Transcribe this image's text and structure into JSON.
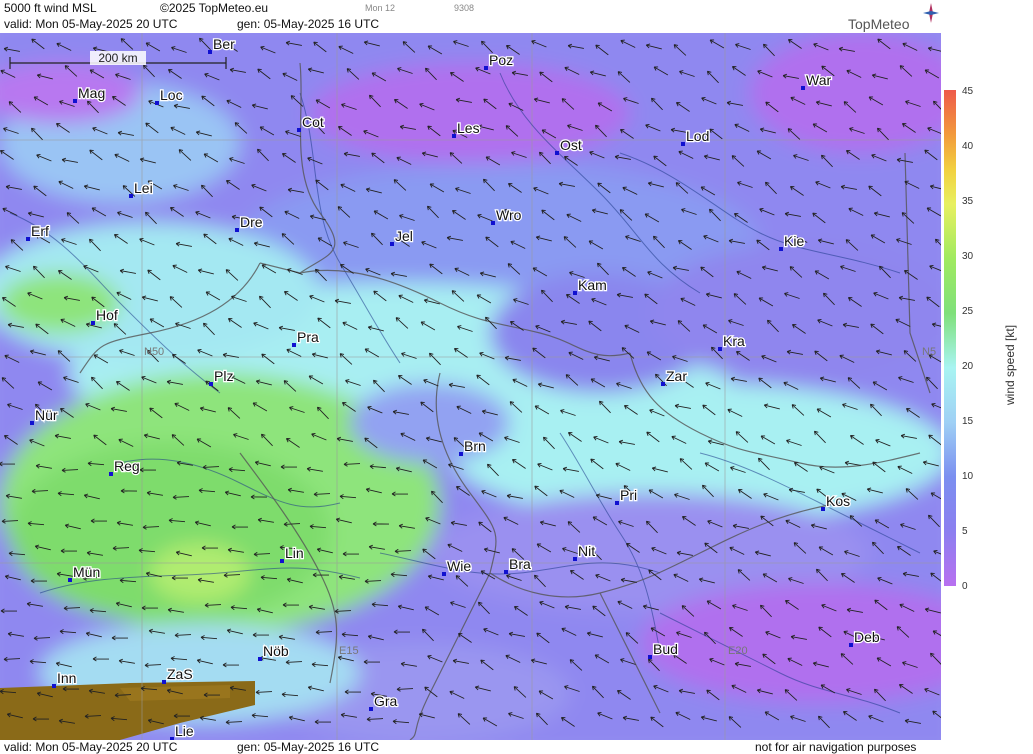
{
  "header": {
    "product": "5000 ft wind MSL",
    "copyright": "©2025 TopMeteo.eu",
    "valid": "valid:  Mon  05-May-2025  20 UTC",
    "gen": "gen: 05-May-2025 16 UTC",
    "step": "Mon 12",
    "code": "9308",
    "logo": "TopMeteo"
  },
  "footer": {
    "valid": "valid:  Mon  05-May-2025  20 UTC",
    "gen": "gen: 05-May-2025 16 UTC",
    "note": "not for air navigation purposes"
  },
  "map": {
    "scale_label": "200 km",
    "grid_labels": [
      "N50",
      "E15",
      "E20",
      "N5"
    ],
    "cities": [
      {
        "name": "Ber"
      },
      {
        "name": "Poz"
      },
      {
        "name": "War"
      },
      {
        "name": "Mag"
      },
      {
        "name": "Loc"
      },
      {
        "name": "Cot"
      },
      {
        "name": "Les"
      },
      {
        "name": "Ost"
      },
      {
        "name": "Lod"
      },
      {
        "name": "Lei"
      },
      {
        "name": "Dre"
      },
      {
        "name": "Wro"
      },
      {
        "name": "Erf"
      },
      {
        "name": "Jel"
      },
      {
        "name": "Kie"
      },
      {
        "name": "Kam"
      },
      {
        "name": "Hof"
      },
      {
        "name": "Pra"
      },
      {
        "name": "Kra"
      },
      {
        "name": "Plz"
      },
      {
        "name": "Zar"
      },
      {
        "name": "Nür"
      },
      {
        "name": "Brn"
      },
      {
        "name": "Reg"
      },
      {
        "name": "Pri"
      },
      {
        "name": "Kos"
      },
      {
        "name": "Lin"
      },
      {
        "name": "Nit"
      },
      {
        "name": "Mün"
      },
      {
        "name": "Wie"
      },
      {
        "name": "Bra"
      },
      {
        "name": "Deb"
      },
      {
        "name": "Nöb"
      },
      {
        "name": "Bud"
      },
      {
        "name": "Inn"
      },
      {
        "name": "ZaS"
      },
      {
        "name": "Gra"
      },
      {
        "name": "Lie"
      }
    ]
  },
  "legend": {
    "title": "wind  speed  [kt]",
    "ticks": [
      "45",
      "40",
      "35",
      "30",
      "25",
      "20",
      "15",
      "10",
      "5",
      "0"
    ],
    "colors": {
      "low": "#b870f0",
      "mid": "#a8f4f2",
      "green": "#7fe07a",
      "high": "#ee5a4a"
    }
  }
}
